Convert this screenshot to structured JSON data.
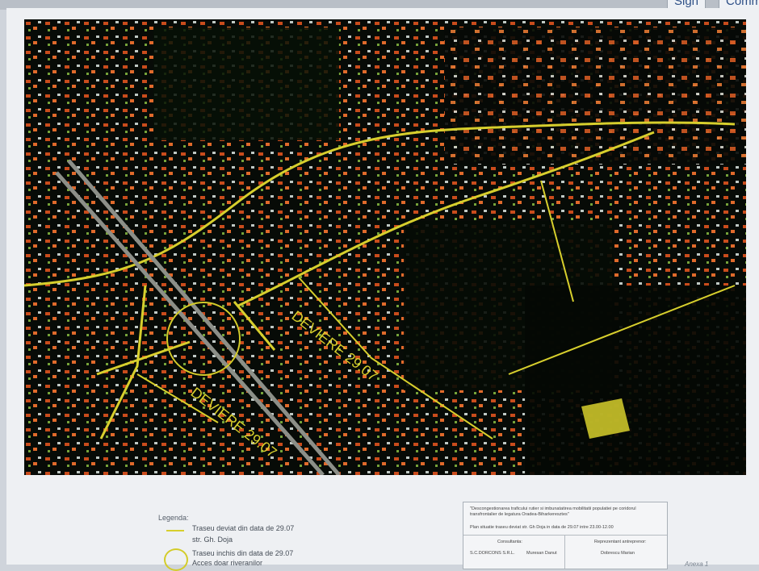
{
  "top_buttons": [
    "Sign",
    "Comm"
  ],
  "map": {
    "label_1": "DEVIERE 29.07",
    "label_2": "DEVIERE 29.07",
    "colors": {
      "route": "#d7cf2d",
      "roof": "#d84d1d",
      "vegetation": "#0f1f0d"
    }
  },
  "legend": {
    "title": "Legenda:",
    "item1_line1": "Traseu deviat din data de 29.07",
    "item1_line2": "str. Gh. Doja",
    "item2_line1": "Traseu inchis din data de 29.07",
    "item2_line2": "Acces doar riveranilor"
  },
  "info_box": {
    "project": "\"Descongestionarea traficului rutier si imbunatatirea mobilitatii populatiei pe coridorul transfrontalier de legatura Oradea-Biharkeresztes\"",
    "plan": "Plan situatie traseu deviat str. Gh Doja in data de 29.07 intre 23.00-12.00",
    "consultant_label": "Consultanta:",
    "consultant_name": "S.C.DORCONS S.R.L.",
    "consultant_person": "Muresan Danut",
    "contractor_label": "Reprezentant antreprenor:",
    "contractor_person": "Dobrescu Marian"
  },
  "annex_note": "Anexa 1"
}
